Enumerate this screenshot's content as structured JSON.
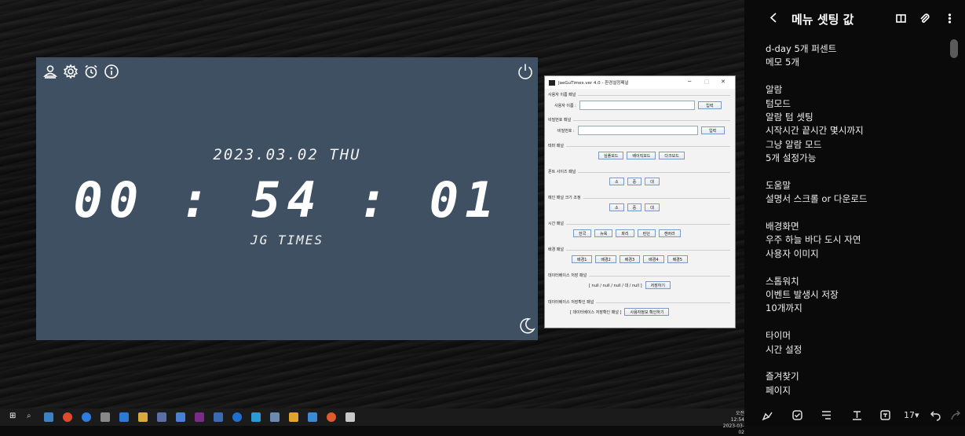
{
  "clock": {
    "date": "2023.03.02 THU",
    "time": "00 : 54 : 01",
    "brand": "JG TIMES"
  },
  "settings": {
    "title": "JaeGuTimes.ver 4.0 - 환경설정패널",
    "panels": {
      "username": {
        "label": "사용자 이름 패널",
        "field_label": "사용자 이름 :",
        "button": "입력"
      },
      "password": {
        "label": "비밀번호 패널",
        "field_label": "비밀번호 :",
        "button": "입력"
      },
      "theme": {
        "label": "테마 패널",
        "buttons": [
          "심플모드",
          "베이직모드",
          "다크모드"
        ]
      },
      "font_size": {
        "label": "폰트 사이즈 패널",
        "buttons": [
          "소",
          "중",
          "대"
        ]
      },
      "main_size": {
        "label": "메인 패널 크기 조정",
        "buttons": [
          "소",
          "중",
          "대"
        ]
      },
      "time": {
        "label": "시간 패널",
        "buttons": [
          "한국",
          "뉴욕",
          "파리",
          "런던",
          "캔버라"
        ]
      },
      "background": {
        "label": "배경 패널",
        "buttons": [
          "배경1",
          "배경2",
          "배경3",
          "배경4",
          "배경5"
        ]
      },
      "db_save": {
        "label": "데이터베이스 저장 패널",
        "value": "[ null / null / null / 대 / null ]",
        "button": "저장하기"
      },
      "db_check": {
        "label": "데이터베이스 저장확인 패널",
        "value": "[ 데이터베이스 저장확인 패널 ]",
        "button": "사용자정보 확인하기"
      }
    }
  },
  "notes": {
    "title": "메뉴 셋팅 값",
    "lines": [
      "d-day 5개 퍼센트",
      "메모 5개",
      "",
      "알람",
      "텀모드",
      "알람  텀 셋팅",
      "시작시간 끝시간 몇시까지",
      "그냥 알람 모드",
      "5개 설정가능",
      "",
      "도움말",
      "설명서 스크롤 or 다운로드",
      "",
      "배경화면",
      "우주 하늘 바다 도시 자연",
      "사용자 이미지",
      "",
      "스톱워치",
      "이벤트 발생시 저장",
      "10개까지",
      "",
      "타이머",
      "시간 설정",
      "",
      "즐겨찾기",
      "페이지"
    ],
    "font_size": "17▾"
  },
  "taskbar": {
    "time": "오전 12:54",
    "date": "2023-03-02"
  }
}
